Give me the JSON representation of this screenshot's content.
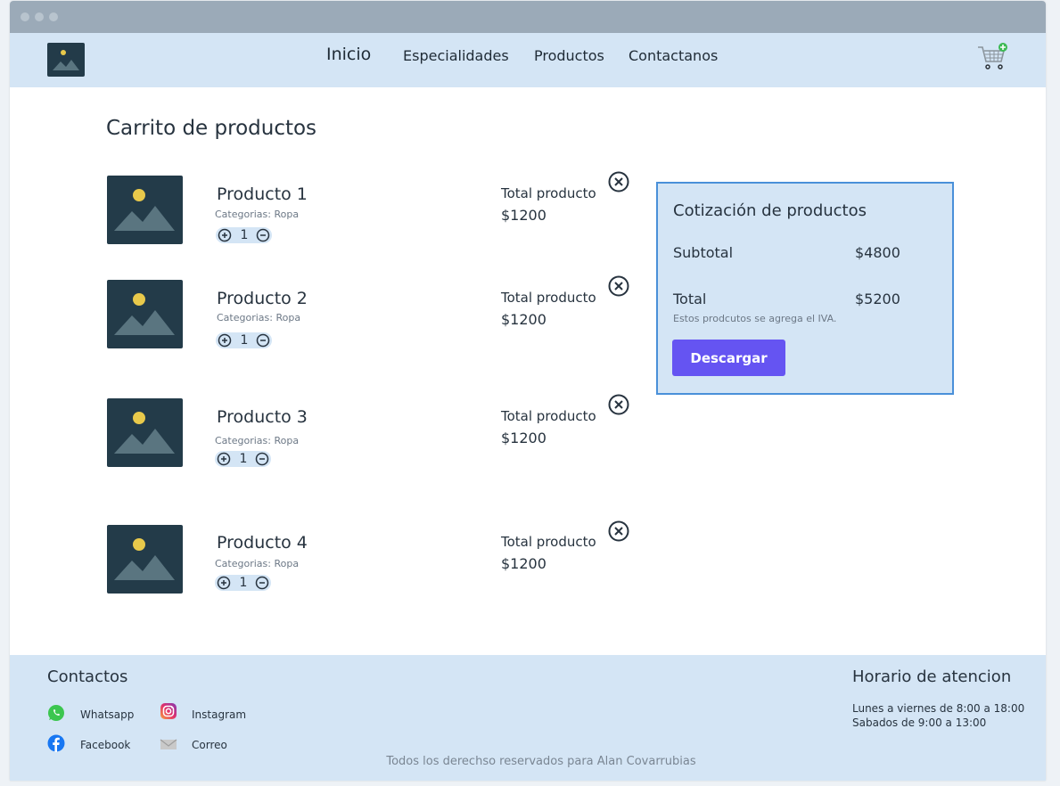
{
  "header": {
    "nav": [
      {
        "label": "Inicio"
      },
      {
        "label": "Especialidades"
      },
      {
        "label": "Productos"
      },
      {
        "label": "Contactanos"
      }
    ]
  },
  "cart": {
    "title": "Carrito de productos",
    "items": [
      {
        "name": "Producto 1",
        "category": "Categorias: Ropa",
        "qty": "1",
        "total_label": "Total producto",
        "total": "$1200"
      },
      {
        "name": "Producto 2",
        "category": "Categorias: Ropa",
        "qty": "1",
        "total_label": "Total producto",
        "total": "$1200"
      },
      {
        "name": "Producto 3",
        "category": "Categorias: Ropa",
        "qty": "1",
        "total_label": "Total producto",
        "total": "$1200"
      },
      {
        "name": "Producto 4",
        "category": "Categorias: Ropa",
        "qty": "1",
        "total_label": "Total producto",
        "total": "$1200"
      }
    ]
  },
  "summary": {
    "title": "Cotización de productos",
    "subtotal_label": "Subtotal",
    "subtotal": "$4800",
    "total_label": "Total",
    "total": "$5200",
    "note": "Estos prodcutos se agrega el IVA.",
    "download_label": "Descargar"
  },
  "footer": {
    "contacts_title": "Contactos",
    "links": {
      "whatsapp": "Whatsapp",
      "instagram": "Instagram",
      "facebook": "Facebook",
      "email": "Correo"
    },
    "hours_title": "Horario de atencion",
    "hours": [
      "Lunes a viernes de 8:00 a 18:00",
      "Sabados de 9:00 a 13:00"
    ],
    "copyright": "Todos los derechso reservados para Alan Covarrubias"
  },
  "colors": {
    "header_bg": "#d4e5f5",
    "accent_button": "#6554f2",
    "summary_border": "#4a90d9",
    "image_placeholder": "#233b49"
  },
  "icons": [
    "image-placeholder-icon",
    "cart-icon",
    "plus-icon",
    "minus-icon",
    "close-circle-icon",
    "whatsapp-icon",
    "instagram-icon",
    "facebook-icon",
    "mail-icon"
  ]
}
